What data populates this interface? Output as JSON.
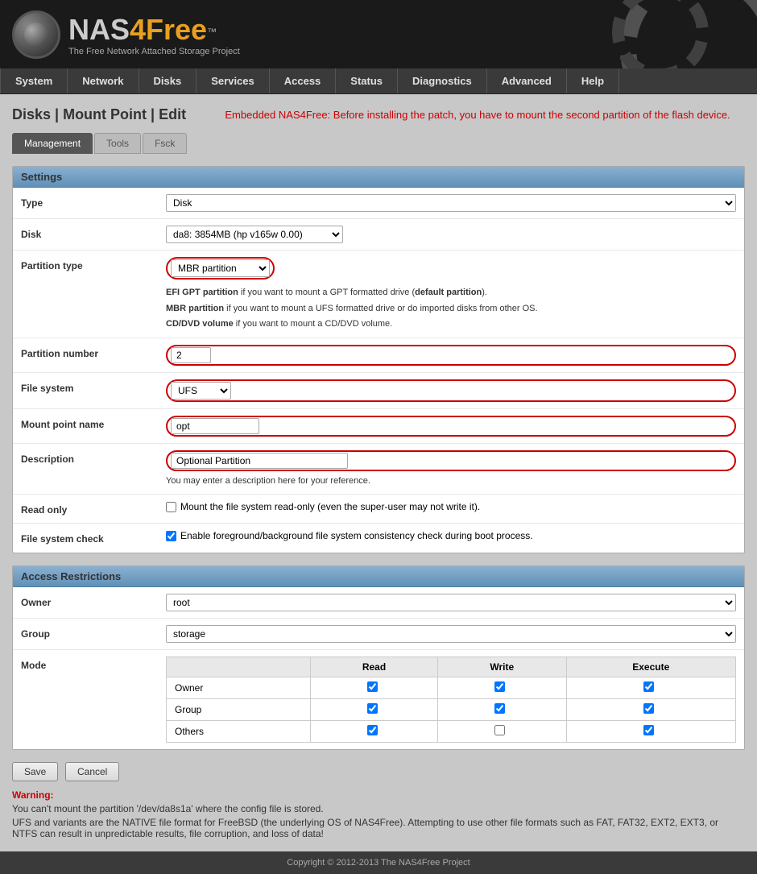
{
  "header": {
    "logo_nas": "NAS",
    "logo_free": "4Free",
    "logo_tm": "™",
    "logo_subtitle": "The Free Network Attached Storage Project"
  },
  "nav": {
    "items": [
      {
        "label": "System",
        "name": "system"
      },
      {
        "label": "Network",
        "name": "network"
      },
      {
        "label": "Disks",
        "name": "disks"
      },
      {
        "label": "Services",
        "name": "services"
      },
      {
        "label": "Access",
        "name": "access"
      },
      {
        "label": "Status",
        "name": "status"
      },
      {
        "label": "Diagnostics",
        "name": "diagnostics"
      },
      {
        "label": "Advanced",
        "name": "advanced"
      },
      {
        "label": "Help",
        "name": "help"
      }
    ]
  },
  "page": {
    "title": "Disks | Mount Point | Edit",
    "notice": "Embedded NAS4Free: Before installing the patch, you have to mount the second partition of the flash device."
  },
  "tabs": [
    {
      "label": "Management",
      "active": true
    },
    {
      "label": "Tools",
      "active": false
    },
    {
      "label": "Fsck",
      "active": false
    }
  ],
  "settings": {
    "section_title": "Settings",
    "type_label": "Type",
    "type_value": "Disk",
    "disk_label": "Disk",
    "disk_value": "da8: 3854MB (hp v165w 0.00)",
    "partition_type_label": "Partition type",
    "partition_type_value": "MBR partition",
    "partition_hint_efi": "EFI GPT partition",
    "partition_hint_efi_desc": " if you want to mount a GPT formatted drive (",
    "partition_hint_efi_bold": "default partition",
    "partition_hint_efi_end": ").",
    "partition_hint_mbr": "MBR partition",
    "partition_hint_mbr_desc": " if you want to mount a UFS formatted drive or do imported disks from other OS.",
    "partition_hint_cd": "CD/DVD volume",
    "partition_hint_cd_desc": " if you want to mount a CD/DVD volume.",
    "partition_number_label": "Partition number",
    "partition_number_value": "2",
    "filesystem_label": "File system",
    "filesystem_value": "UFS",
    "mount_point_label": "Mount point name",
    "mount_point_value": "opt",
    "description_label": "Description",
    "description_value": "Optional Partition",
    "description_hint": "You may enter a description here for your reference.",
    "readonly_label": "Read only",
    "readonly_hint": "Mount the file system read-only (even the super-user may not write it).",
    "fscheck_label": "File system check",
    "fscheck_hint": "Enable foreground/background file system consistency check during boot process."
  },
  "access": {
    "section_title": "Access Restrictions",
    "owner_label": "Owner",
    "owner_value": "root",
    "group_label": "Group",
    "group_value": "storage",
    "mode_label": "Mode",
    "mode_col_read": "Read",
    "mode_col_write": "Write",
    "mode_col_execute": "Execute",
    "mode_rows": [
      {
        "name": "Owner",
        "read": true,
        "write": true,
        "execute": true
      },
      {
        "name": "Group",
        "read": true,
        "write": true,
        "execute": true
      },
      {
        "name": "Others",
        "read": true,
        "write": false,
        "execute": true
      }
    ]
  },
  "buttons": {
    "save": "Save",
    "cancel": "Cancel"
  },
  "warning": {
    "title": "Warning:",
    "line1": "You can't mount the partition '/dev/da8s1a' where the config file is stored.",
    "line2": "UFS and variants are the NATIVE file format for FreeBSD (the underlying OS of NAS4Free). Attempting to use other file formats such as FAT, FAT32, EXT2, EXT3, or NTFS can result in unpredictable results, file corruption, and loss of data!"
  },
  "footer": {
    "text": "Copyright © 2012-2013 The NAS4Free Project"
  }
}
